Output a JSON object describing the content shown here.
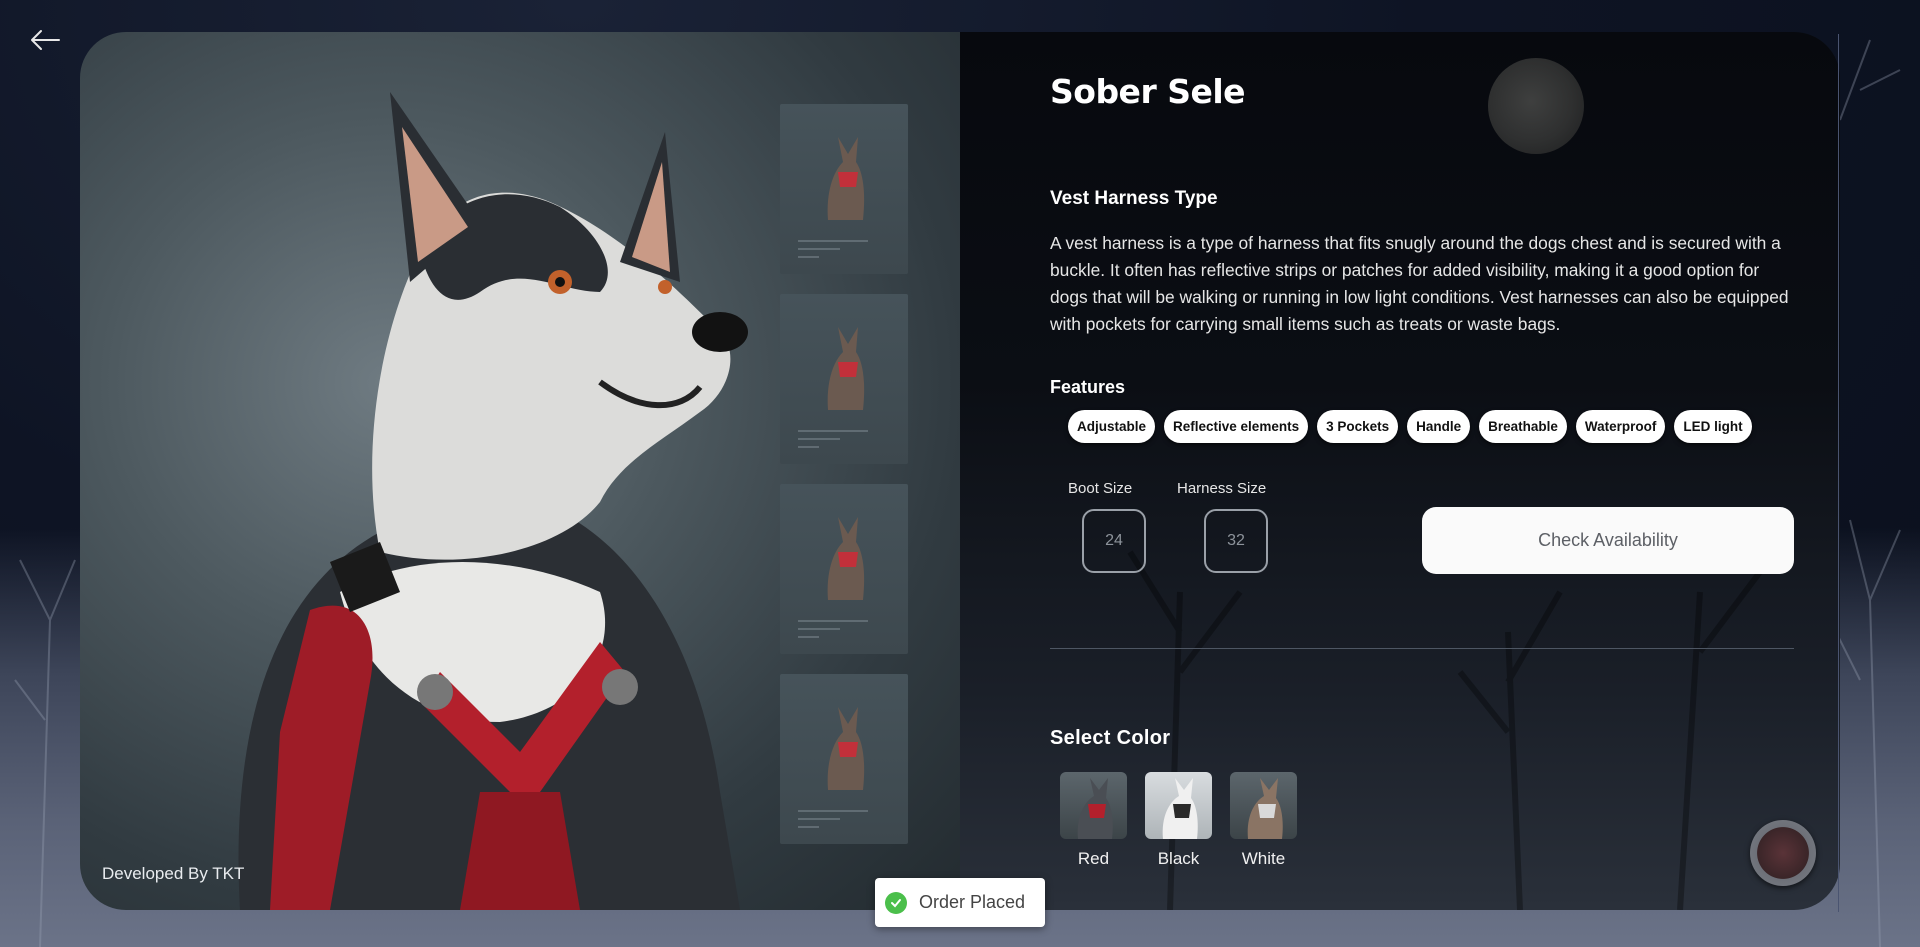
{
  "navigation": {
    "back_icon": "arrow-left-icon"
  },
  "product": {
    "title": "Sober Sele",
    "type_heading": "Vest Harness Type",
    "description": "A vest harness is a type of harness that fits snugly around the dogs chest and is secured with a buckle. It often has reflective strips or patches for added visibility, making it a good option for dogs that will be walking or running in low light conditions. Vest harnesses can also be equipped with pockets for carrying small items such as treats or waste bags.",
    "features_heading": "Features",
    "features": [
      "Adjustable",
      "Reflective elements",
      "3 Pockets",
      "Handle",
      "Breathable",
      "Waterproof",
      "LED light"
    ],
    "boot_size": {
      "label": "Boot Size",
      "value": "24"
    },
    "harness_size": {
      "label": "Harness Size",
      "value": "32"
    },
    "check_button": "Check Availability",
    "select_color_heading": "Select Color",
    "colors": [
      {
        "name": "Red",
        "harness": "#b3202c"
      },
      {
        "name": "Black",
        "harness": "#2a2a2a"
      },
      {
        "name": "White",
        "harness": "#d9d9d9"
      }
    ]
  },
  "gallery": {
    "thumbnail_count": 4
  },
  "credit": "Developed By TKT",
  "toast": {
    "text": "Order Placed",
    "icon": "check-circle-icon"
  },
  "colors": {
    "accent_red": "#b3202c",
    "toast_green": "#4bbf4b"
  }
}
